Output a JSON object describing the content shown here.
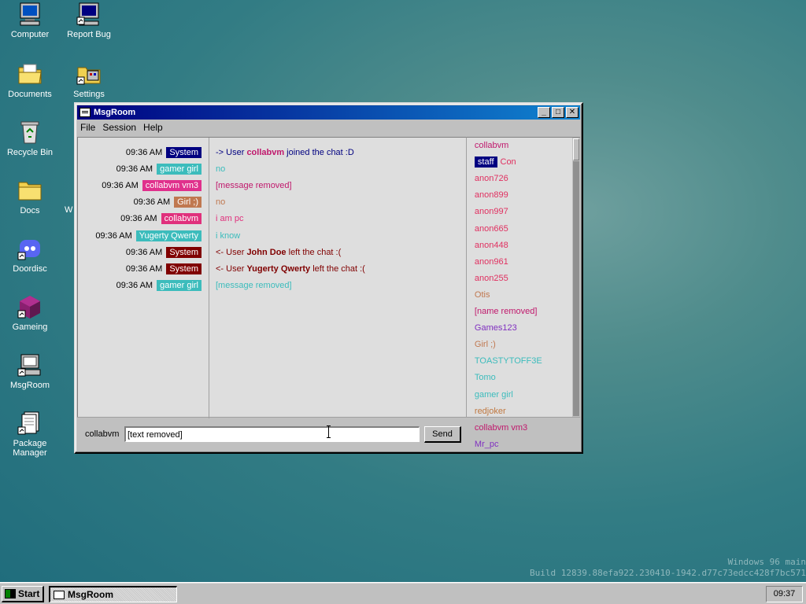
{
  "desktop": {
    "icons": [
      {
        "label": "Computer"
      },
      {
        "label": "Report Bug"
      },
      {
        "label": "Documents"
      },
      {
        "label": "Settings"
      },
      {
        "label": "Recycle Bin"
      },
      {
        "label": "Docs"
      },
      {
        "label": "Doordisc"
      },
      {
        "label": "Gameing"
      },
      {
        "label": "MsgRoom"
      },
      {
        "label": "Package Manager"
      }
    ],
    "hidden_icon_fragment": "W"
  },
  "window": {
    "title": "MsgRoom",
    "menu": [
      "File",
      "Session",
      "Help"
    ],
    "messages": [
      {
        "time": "09:36 AM",
        "nick": "System",
        "nick_color": "#000080",
        "pre": "-> User ",
        "bold": "collabvm",
        "post": " joined the chat :D",
        "text": "",
        "text_color": "#000080",
        "bold_color": "#c0186c"
      },
      {
        "time": "09:36 AM",
        "nick": "gamer girl",
        "nick_color": "#3cbcbc",
        "pre": "",
        "bold": "",
        "post": "",
        "text": "no",
        "text_color": "#3cbcbc"
      },
      {
        "time": "09:36 AM",
        "nick": "collabvm vm3",
        "nick_color": "#e0308c",
        "pre": "",
        "bold": "",
        "post": "",
        "text": "[message removed]",
        "text_color": "#c0186c"
      },
      {
        "time": "09:36 AM",
        "nick": "Girl ;)",
        "nick_color": "#c07850",
        "pre": "",
        "bold": "",
        "post": "",
        "text": "no",
        "text_color": "#c07850"
      },
      {
        "time": "09:36 AM",
        "nick": "collabvm",
        "nick_color": "#e0307c",
        "pre": "",
        "bold": "",
        "post": "",
        "text": "i am pc",
        "text_color": "#e0307c"
      },
      {
        "time": "09:36 AM",
        "nick": "Yugerty Qwerty",
        "nick_color": "#3cbcbc",
        "pre": "",
        "bold": "",
        "post": "",
        "text": "i know",
        "text_color": "#3cbcbc"
      },
      {
        "time": "09:36 AM",
        "nick": "System",
        "nick_color": "#800000",
        "pre": "<- User ",
        "bold": "John Doe",
        "post": " left the chat :(",
        "text": "",
        "text_color": "#800000",
        "bold_color": "#800000"
      },
      {
        "time": "09:36 AM",
        "nick": "System",
        "nick_color": "#800000",
        "pre": "<- User ",
        "bold": "Yugerty Qwerty",
        "post": " left the chat :(",
        "text": "",
        "text_color": "#800000",
        "bold_color": "#800000"
      },
      {
        "time": "09:36 AM",
        "nick": "gamer girl",
        "nick_color": "#3cbcbc",
        "pre": "",
        "bold": "",
        "post": "",
        "text": "[message removed]",
        "text_color": "#3cbcbc"
      }
    ],
    "users": [
      {
        "name": "collabvm",
        "color": "#c0186c"
      },
      {
        "badge": "staff",
        "name": "Con",
        "color": "#e03060"
      },
      {
        "name": "anon726",
        "color": "#e03060"
      },
      {
        "name": "anon899",
        "color": "#e03060"
      },
      {
        "name": "anon997",
        "color": "#e03060"
      },
      {
        "name": "anon665",
        "color": "#e03060"
      },
      {
        "name": "anon448",
        "color": "#e03060"
      },
      {
        "name": "anon961",
        "color": "#e03060"
      },
      {
        "name": "anon255",
        "color": "#e03060"
      },
      {
        "name": "Otis",
        "color": "#c07850"
      },
      {
        "name": "[name removed]",
        "color": "#c0186c"
      },
      {
        "name": "Games123",
        "color": "#8030c0"
      },
      {
        "name": "Girl ;)",
        "color": "#c07850"
      },
      {
        "name": "TOASTYTOFF3E",
        "color": "#3cbcbc"
      },
      {
        "name": "Tomo",
        "color": "#3cbcbc"
      },
      {
        "name": "gamer girl",
        "color": "#3cbcbc"
      },
      {
        "name": "redjoker",
        "color": "#c07840"
      },
      {
        "name": "collabvm vm3",
        "color": "#c0186c"
      },
      {
        "name": "Mr_pc",
        "color": "#8030c0"
      }
    ],
    "input": {
      "nick": "collabvm",
      "value": "[text removed]",
      "send_label": "Send"
    }
  },
  "watermark": {
    "line1": "Windows 96 main",
    "line2": "Build 12839.88efa922.230410-1942.d77c73edcc428f7bc571"
  },
  "taskbar": {
    "start_label": "Start",
    "task_label": "MsgRoom",
    "clock": "09:37"
  }
}
